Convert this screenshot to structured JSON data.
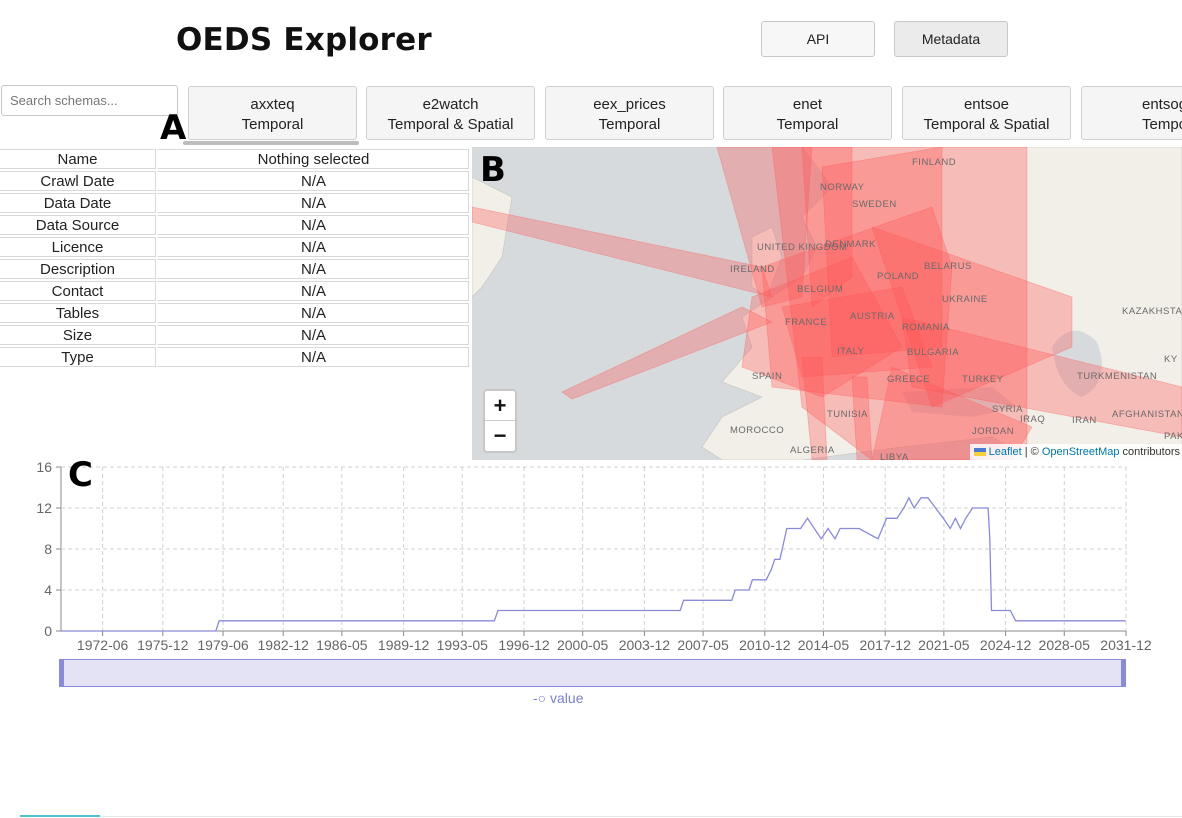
{
  "app": {
    "title": "OEDS Explorer"
  },
  "header_buttons": {
    "api": "API",
    "metadata": "Metadata"
  },
  "search": {
    "placeholder": "Search schemas..."
  },
  "schemas": [
    {
      "name": "axxteq",
      "type": "Temporal"
    },
    {
      "name": "e2watch",
      "type": "Temporal & Spatial"
    },
    {
      "name": "eex_prices",
      "type": "Temporal"
    },
    {
      "name": "enet",
      "type": "Temporal"
    },
    {
      "name": "entsoe",
      "type": "Temporal & Spatial"
    },
    {
      "name": "entsog",
      "type": "Temporal"
    }
  ],
  "panel_labels": {
    "a": "A",
    "b": "B",
    "c": "C"
  },
  "metadata_table": [
    {
      "key": "Name",
      "value": "Nothing selected"
    },
    {
      "key": "Crawl Date",
      "value": "N/A"
    },
    {
      "key": "Data Date",
      "value": "N/A"
    },
    {
      "key": "Data Source",
      "value": "N/A"
    },
    {
      "key": "Licence",
      "value": "N/A"
    },
    {
      "key": "Description",
      "value": "N/A"
    },
    {
      "key": "Contact",
      "value": "N/A"
    },
    {
      "key": "Tables",
      "value": "N/A"
    },
    {
      "key": "Size",
      "value": "N/A"
    },
    {
      "key": "Type",
      "value": "N/A"
    }
  ],
  "map": {
    "zoom_in": "+",
    "zoom_out": "−",
    "attribution_leaflet": "Leaflet",
    "attribution_sep": " | © ",
    "attribution_osm": "OpenStreetMap",
    "attribution_tail": " contributors",
    "labels": [
      "FINLAND",
      "NORWAY",
      "SWEDEN",
      "UNITED KINGDOM",
      "IRELAND",
      "DENMARK",
      "BELARUS",
      "POLAND",
      "BELGIUM",
      "UKRAINE",
      "FRANCE",
      "AUSTRIA",
      "ROMANIA",
      "KAZAKHSTAN",
      "ITALY",
      "BULGARIA",
      "SPAIN",
      "GREECE",
      "TURKEY",
      "TURKMENISTAN",
      "TUNISIA",
      "SYRIA",
      "IRAQ",
      "IRAN",
      "AFGHANISTAN",
      "MOROCCO",
      "JORDAN",
      "ALGERIA",
      "LIBYA",
      "PAKIS",
      "KY"
    ],
    "overlay_color": "#ff5555",
    "land_color": "#f2efe9",
    "water_color": "#d6dadc"
  },
  "chart_data": {
    "type": "line",
    "series": [
      {
        "name": "value",
        "color": "#8a8ad8",
        "x": [
          1970.0,
          1979.0,
          1979.2,
          1995.2,
          1995.4,
          2006.0,
          2006.2,
          2009.0,
          2009.2,
          2010.0,
          2010.2,
          2011.0,
          2011.3,
          2011.5,
          2011.8,
          2012.2,
          2013.0,
          2013.4,
          2014.2,
          2014.6,
          2015.0,
          2015.3,
          2015.6,
          2016.0,
          2016.4,
          2017.5,
          2018.0,
          2018.6,
          2019.0,
          2019.3,
          2019.6,
          2020.0,
          2020.4,
          2021.3,
          2021.7,
          2022.0,
          2022.3,
          2022.6,
          2023.0,
          2023.3,
          2023.9,
          2024.0,
          2024.1,
          2025.2,
          2025.5,
          2031.9
        ],
        "y": [
          0,
          0,
          1,
          1,
          2,
          2,
          3,
          3,
          4,
          4,
          5,
          5,
          6,
          7,
          7,
          10,
          10,
          11,
          9,
          10,
          9,
          10,
          10,
          10,
          10,
          9,
          11,
          11,
          12,
          13,
          12,
          13,
          13,
          11,
          10,
          11,
          10,
          11,
          12,
          12,
          12,
          9,
          2,
          2,
          1,
          1
        ]
      }
    ],
    "x_ticks": [
      "1972-06",
      "1975-12",
      "1979-06",
      "1982-12",
      "1986-05",
      "1989-12",
      "1993-05",
      "1996-12",
      "2000-05",
      "2003-12",
      "2007-05",
      "2010-12",
      "2014-05",
      "2017-12",
      "2021-05",
      "2024-12",
      "2028-05",
      "2031-12"
    ],
    "x_tick_values": [
      1972.42,
      1975.92,
      1979.42,
      1982.92,
      1986.33,
      1989.92,
      1993.33,
      1996.92,
      2000.33,
      2003.92,
      2007.33,
      2010.92,
      2014.33,
      2017.92,
      2021.33,
      2024.92,
      2028.33,
      2031.92
    ],
    "xlim": [
      1970.0,
      2031.92
    ],
    "ylim": [
      0,
      16
    ],
    "y_ticks": [
      0,
      4,
      8,
      12,
      16
    ],
    "grid": true,
    "legend": "bottom-center",
    "legend_label": "value"
  }
}
